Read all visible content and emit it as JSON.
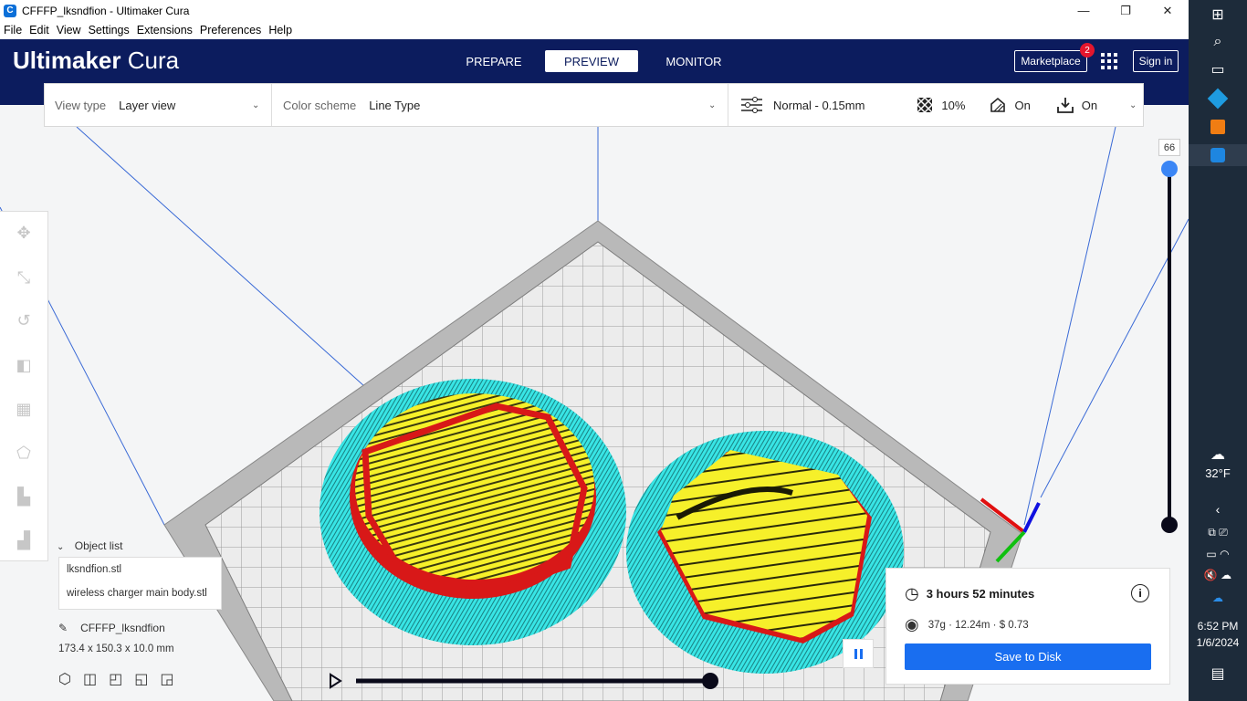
{
  "window": {
    "title": "CFFFP_lksndfion - Ultimaker Cura",
    "minimize": "—",
    "maximize": "❐",
    "close": "✕"
  },
  "menu": [
    "File",
    "Edit",
    "View",
    "Settings",
    "Extensions",
    "Preferences",
    "Help"
  ],
  "header": {
    "logo_bold": "Ultimaker",
    "logo_light": "Cura",
    "tabs": [
      "PREPARE",
      "PREVIEW",
      "MONITOR"
    ],
    "active_tab": "PREVIEW",
    "marketplace": "Marketplace",
    "marketplace_badge": "2",
    "sign_in": "Sign in"
  },
  "view_toolbar": {
    "view_type_label": "View type",
    "view_type_value": "Layer view",
    "color_scheme_label": "Color scheme",
    "color_scheme_value": "Line Type",
    "profile": "Normal - 0.15mm",
    "infill": "10%",
    "support": "On",
    "adhesion": "On"
  },
  "layer_slider": {
    "current_layer": "66"
  },
  "object_list": {
    "header": "Object list",
    "items": [
      "lksndfion.stl",
      "wireless charger main body.stl"
    ],
    "project_name": "CFFFP_lksndfion",
    "dimensions": "173.4 x 150.3 x 10.0 mm"
  },
  "print_info": {
    "time": "3 hours 52 minutes",
    "material": "37g · 12.24m · $ 0.73",
    "save_button": "Save to Disk"
  },
  "taskbar": {
    "weather": "32°F",
    "time": "6:52 PM",
    "date": "1/6/2024"
  },
  "colors": {
    "header": "#0c1c5e",
    "accent": "#196ef0",
    "skirt": "#33e6e6",
    "infill": "#ffff33",
    "wall": "#e01a1a"
  }
}
